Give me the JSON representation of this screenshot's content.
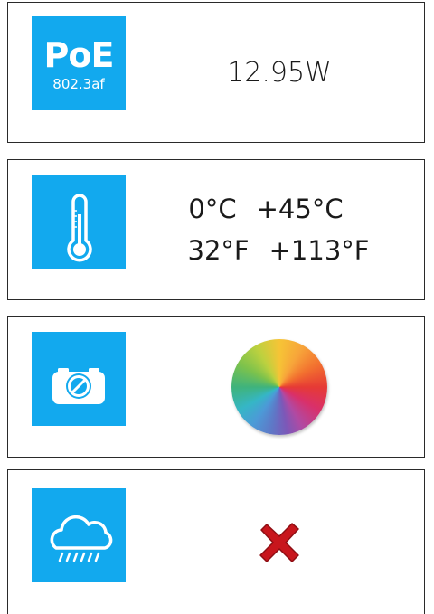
{
  "poe": {
    "icon": "poe-icon",
    "title": "PoE",
    "standard": "802.3af",
    "power": "12.95W"
  },
  "temperature": {
    "icon": "thermometer-icon",
    "celsius_min": "0°C",
    "celsius_max": "+45°C",
    "fahrenheit_min": "32°F",
    "fahrenheit_max": "+113°F"
  },
  "color": {
    "icon": "camera-icon",
    "indicator": "color-wheel-icon"
  },
  "weather": {
    "icon": "rain-cloud-icon",
    "indicator": "x-mark-icon",
    "supported": false
  },
  "colors": {
    "tile": "#12a9ee",
    "border": "#2a2a2a",
    "text": "#1a1a1a",
    "x_mark": "#c8161d"
  }
}
